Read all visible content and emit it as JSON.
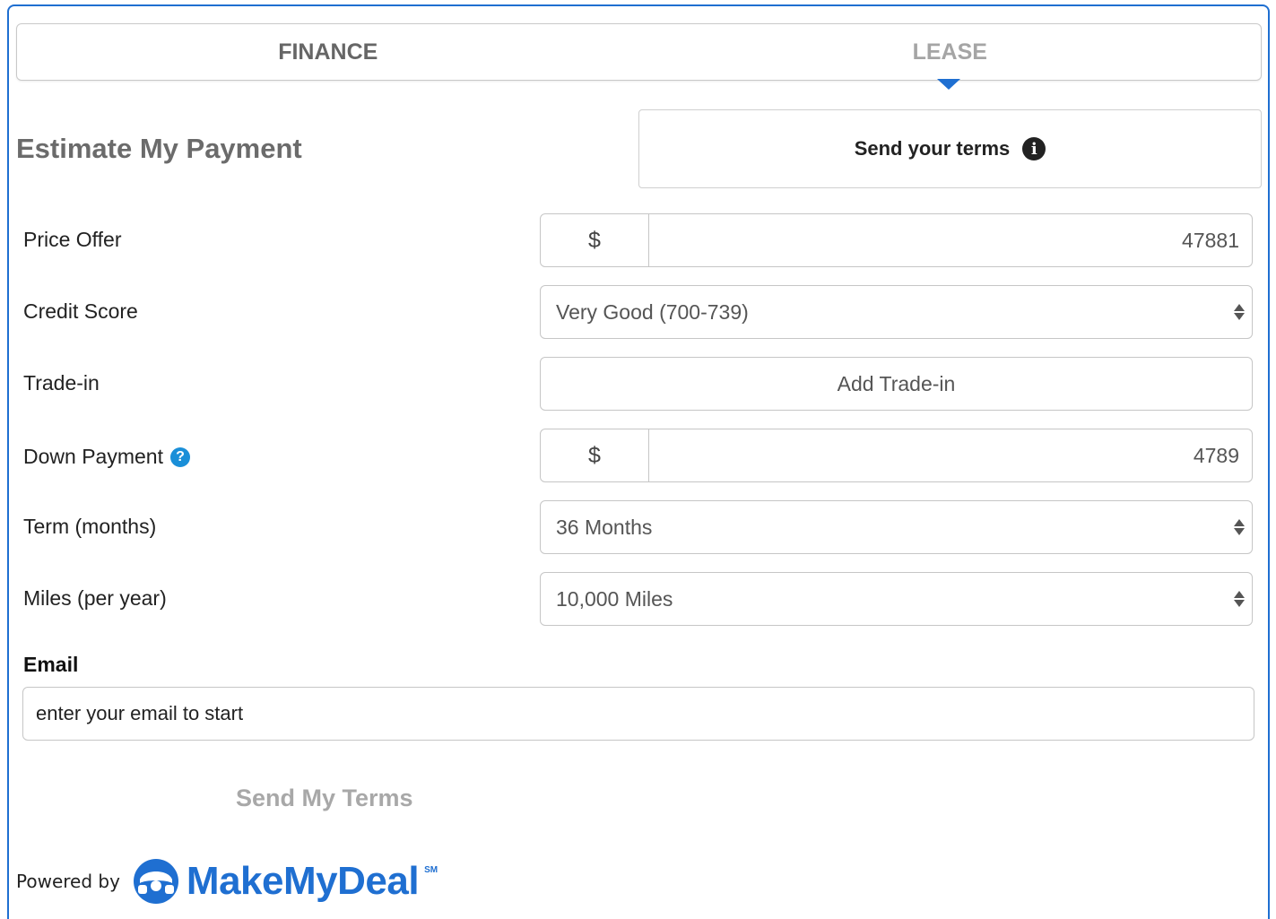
{
  "tabs": [
    {
      "label": "FINANCE",
      "active": true
    },
    {
      "label": "LEASE",
      "active": false
    }
  ],
  "title": "Estimate My Payment",
  "send_terms_label": "Send your terms",
  "fields": {
    "price_offer": {
      "label": "Price Offer",
      "prefix": "$",
      "value": "47881"
    },
    "credit_score": {
      "label": "Credit Score",
      "value": "Very Good (700-739)"
    },
    "trade_in": {
      "label": "Trade-in",
      "button": "Add Trade-in"
    },
    "down_payment": {
      "label": "Down Payment",
      "prefix": "$",
      "value": "4789"
    },
    "term": {
      "label": "Term (months)",
      "value": "36 Months"
    },
    "miles": {
      "label": "Miles (per year)",
      "value": "10,000 Miles"
    }
  },
  "email": {
    "label": "Email",
    "placeholder": "enter your email to start"
  },
  "submit_label": "Send My Terms",
  "powered_by": "Powered by",
  "brand": {
    "name": "MakeMyDeal",
    "mark": "SM"
  },
  "colors": {
    "accent": "#1f6fd1",
    "help": "#1a8fd8",
    "muted": "#a8a8a8"
  }
}
